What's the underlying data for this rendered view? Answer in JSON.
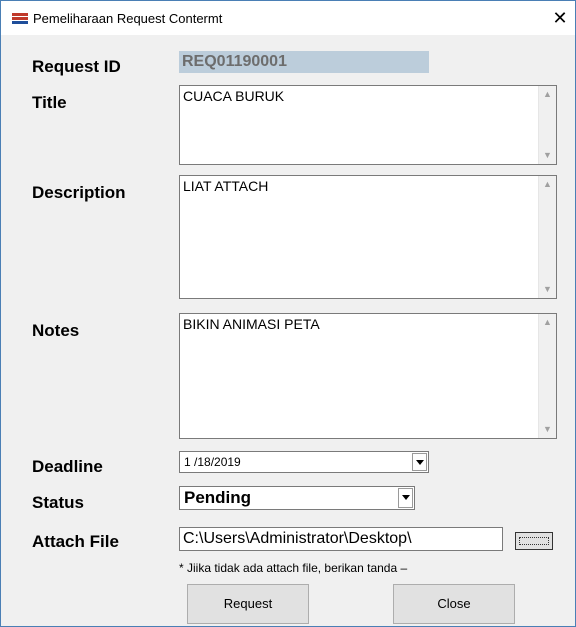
{
  "window": {
    "title": "Pemeliharaan Request Contermt",
    "close_glyph": "✕"
  },
  "labels": {
    "request_id": "Request ID",
    "title": "Title",
    "description": "Description",
    "notes": "Notes",
    "deadline": "Deadline",
    "status": "Status",
    "attach_file": "Attach File"
  },
  "fields": {
    "request_id": "REQ01190001",
    "title": "CUACA BURUK",
    "description": "LIAT ATTACH",
    "notes": "BIKIN ANIMASI PETA",
    "deadline": "1 /18/2019",
    "status": "Pending",
    "attach_file": "C:\\Users\\Administrator\\Desktop\\"
  },
  "hint": "* Jiika tidak ada attach file, berikan tanda  –",
  "buttons": {
    "request": "Request",
    "close": "Close"
  },
  "icons": {
    "app": "app-logo-icon",
    "scroll_up": "scroll-up-icon",
    "scroll_down": "scroll-down-icon"
  },
  "colors": {
    "request_id_bg": "#bccddb",
    "window_bg": "#f0f0f0",
    "border": "#4a7fb5"
  }
}
